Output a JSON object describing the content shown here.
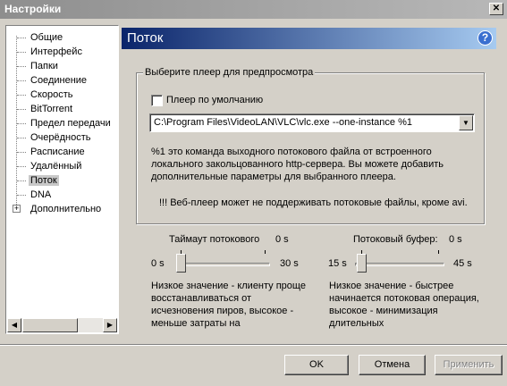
{
  "window": {
    "title": "Настройки",
    "close_glyph": "✕"
  },
  "sidebar": {
    "items": [
      {
        "label": "Общие"
      },
      {
        "label": "Интерфейс"
      },
      {
        "label": "Папки"
      },
      {
        "label": "Соединение"
      },
      {
        "label": "Скорость"
      },
      {
        "label": "BitTorrent"
      },
      {
        "label": "Предел передачи"
      },
      {
        "label": "Очерёдность"
      },
      {
        "label": "Расписание"
      },
      {
        "label": "Удалённый"
      },
      {
        "label": "Поток",
        "selected": true
      },
      {
        "label": "DNA"
      },
      {
        "label": "Дополнительно",
        "expandable": true
      }
    ],
    "expand_glyph": "+"
  },
  "header": {
    "title": "Поток",
    "help_glyph": "?"
  },
  "player_group": {
    "title": "Выберите плеер для предпросмотра",
    "default_player_label": "Плеер по умолчанию",
    "default_player_checked": false,
    "player_command": "C:\\Program Files\\VideoLAN\\VLC\\vlc.exe --one-instance %1",
    "description": "%1 это команда выходного потокового файла от встроенного локального закольцованного http-сервера. Вы можете добавить дополнительные параметры для выбранного плеера.",
    "warning": "!!! Веб-плеер может не поддерживать потоковые файлы, кроме avi."
  },
  "timeout_slider": {
    "title": "Таймаут потокового",
    "current": "0 s",
    "min": "0 s",
    "max": "30 s",
    "value_fraction": 0,
    "description": "Низкое значение - клиенту проще восстанавливаться от исчезновения пиров, высокое - меньше затраты на"
  },
  "buffer_slider": {
    "title": "Потоковый буфер:",
    "current": "0 s",
    "min": "15 s",
    "max": "45 s",
    "value_fraction": 0,
    "description": "Низкое значение - быстрее начинается потоковая операция, высокое - минимизация длительных"
  },
  "buttons": {
    "ok": "OK",
    "cancel": "Отмена",
    "apply": "Применить"
  },
  "colors": {
    "header_start": "#0a246a",
    "header_end": "#a6caf0",
    "window_bg": "#d4d0c8",
    "selected_bg": "#c8c8c8"
  },
  "icons": {
    "help": "help-icon",
    "close": "close-icon",
    "combo_arrow": "chevron-down-icon",
    "scroll_left": "arrow-left-icon",
    "scroll_right": "arrow-right-icon"
  }
}
